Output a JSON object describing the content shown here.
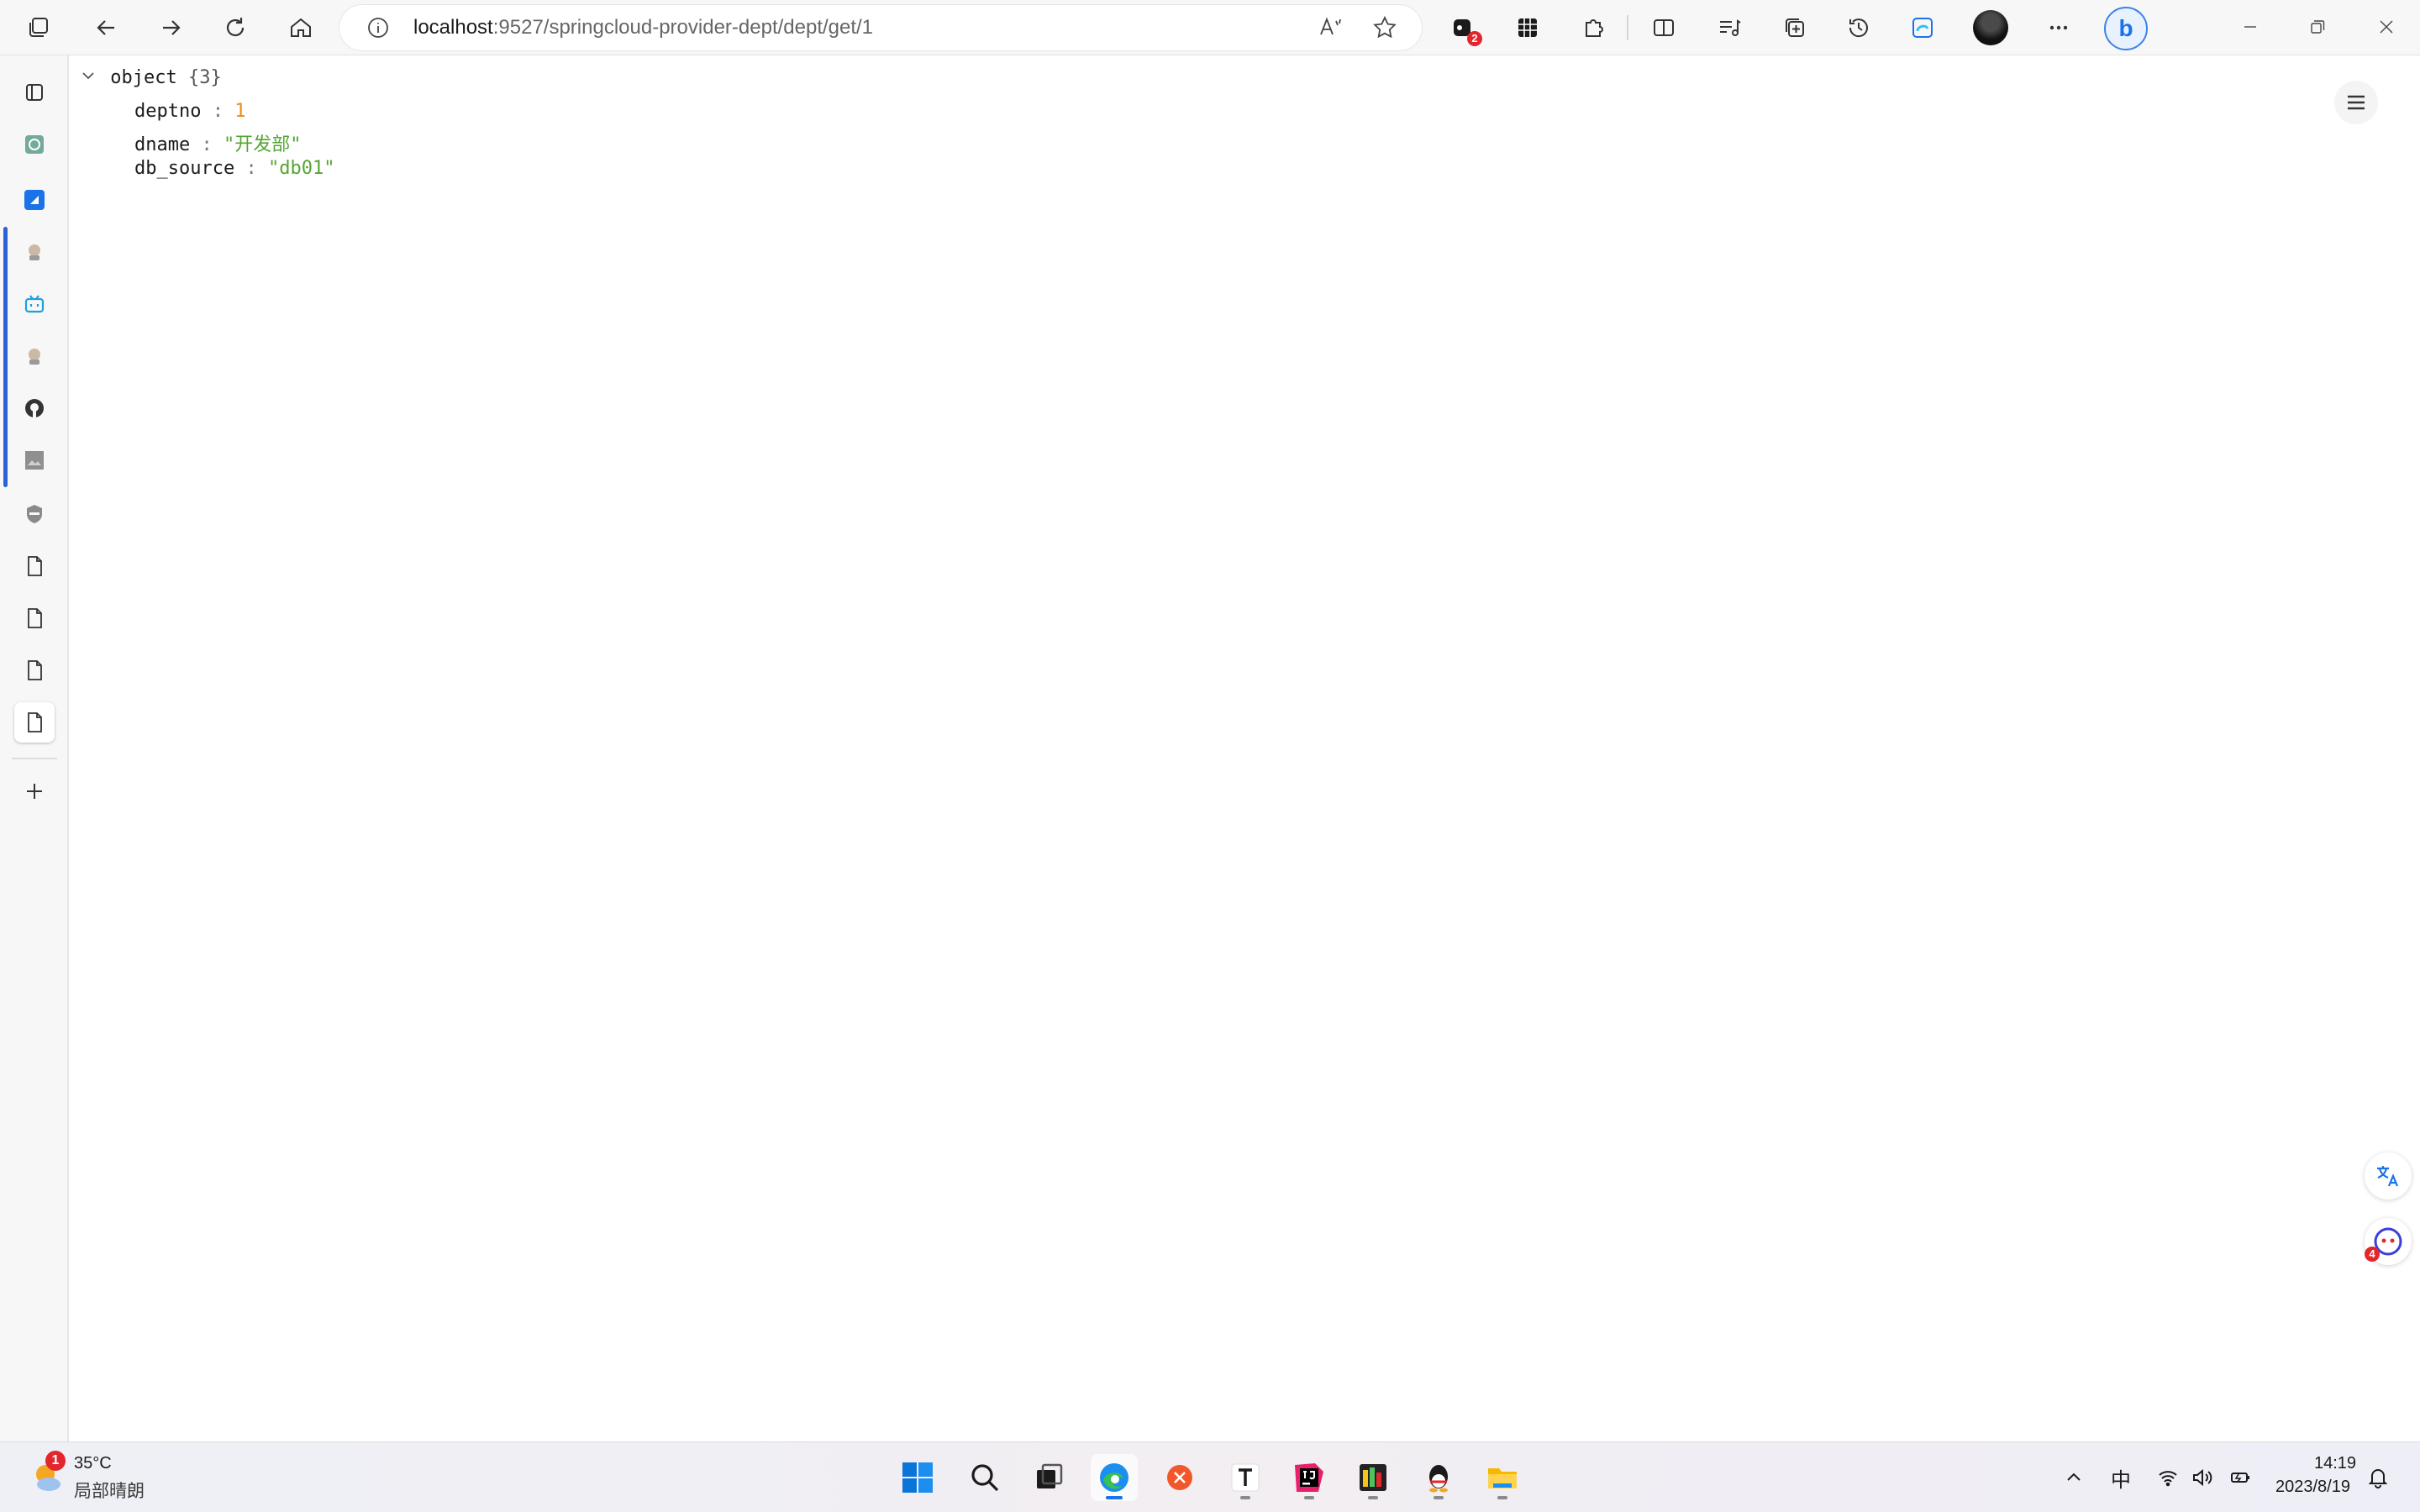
{
  "browser": {
    "address": {
      "host": "localhost",
      "path": ":9527/springcloud-provider-dept/dept/get/1"
    },
    "extension_badge": "2"
  },
  "json_viewer": {
    "root_label": "object",
    "root_count": "{3}",
    "entries": [
      {
        "key": "deptno",
        "value": "1"
      },
      {
        "key": "dname",
        "value": "\"开发部\""
      },
      {
        "key": "db_source",
        "value": "\"db01\""
      }
    ],
    "separator": ":"
  },
  "float_badge": "4",
  "taskbar": {
    "weather_temp": "35°C",
    "weather_desc": "局部晴朗",
    "weather_badge": "1",
    "ime": "中",
    "time": "14:19",
    "date": "2023/8/19"
  },
  "colors": {
    "number": "#f2891a",
    "string": "#55a532",
    "accent": "#1a73e8"
  }
}
